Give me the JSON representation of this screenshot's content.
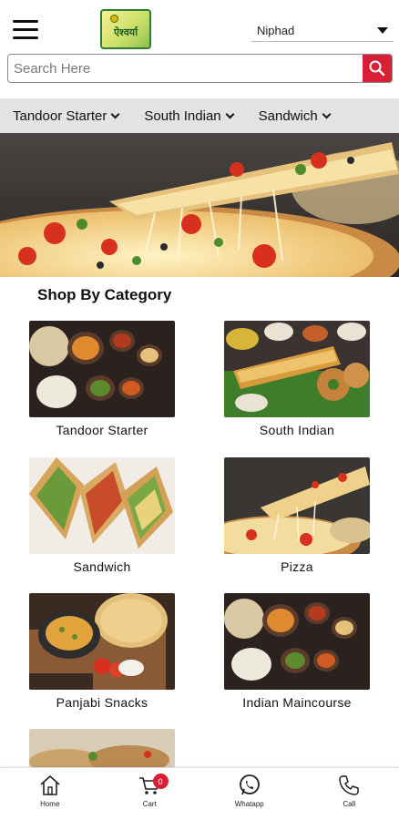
{
  "header": {
    "logo_text": "ऐश्वर्या",
    "location": "Niphad"
  },
  "search": {
    "placeholder": "Search Here"
  },
  "category_strip": [
    "Tandoor Starter",
    "South Indian",
    "Sandwich"
  ],
  "section": {
    "title": "Shop By Category"
  },
  "categories": [
    {
      "label": "Tandoor Starter"
    },
    {
      "label": "South Indian"
    },
    {
      "label": "Sandwich"
    },
    {
      "label": "Pizza"
    },
    {
      "label": "Panjabi Snacks"
    },
    {
      "label": "Indian Maincourse"
    }
  ],
  "bottom_nav": {
    "home": "Home",
    "cart": "Cart",
    "cart_count": "0",
    "whatsapp": "Whatapp",
    "call": "Call"
  },
  "colors": {
    "accent_red": "#d81f35",
    "strip_gray": "#e3e3e3"
  }
}
